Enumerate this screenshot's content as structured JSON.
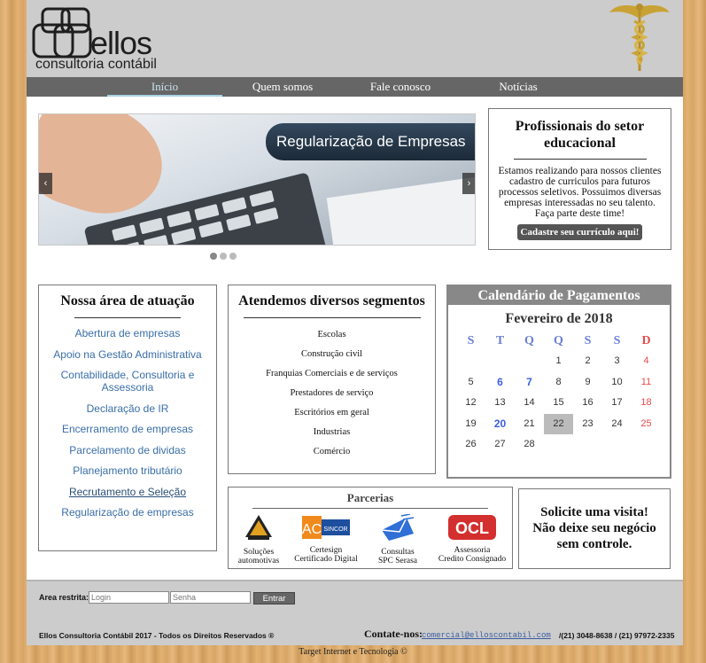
{
  "header": {
    "logo_name": "ellos",
    "logo_sub": "consultoria contábil"
  },
  "nav": {
    "items": [
      "Início",
      "Quem somos",
      "Fale conosco",
      "Notícias"
    ],
    "active": "Início"
  },
  "slider": {
    "banner": "Regularização de Empresas",
    "prev_icon": "chevron-left-icon",
    "next_icon": "chevron-right-icon",
    "prev_symbol": "‹",
    "next_symbol": "›",
    "slide_count": 3,
    "current_slide": 1
  },
  "professionals": {
    "title": "Profissionais do setor educacional",
    "text": "Estamos realizando para nossos clientes cadastro de curriculos para futuros processos seletivos. Possuimos diversas empresas interessadas no seu talento. Faça parte deste time!",
    "button": "Cadastre seu currículo aqui!"
  },
  "area": {
    "title": "Nossa área de atuação",
    "items": [
      "Abertura de empresas",
      "Apoio na Gestão Administrativa",
      "Contabilidade, Consultoria e Assessoria",
      "Declaração de IR",
      "Encerramento de empresas",
      "Parcelamento de dividas",
      "Planejamento tributário",
      "Recrutamento e Seleção",
      "Regularização de empresas"
    ]
  },
  "segments": {
    "title": "Atendemos diversos segmentos",
    "items": [
      "Escolas",
      "Construção civil",
      "Franquias Comerciais e de serviços",
      "Prestadores de serviço",
      "Escritórios em geral",
      "Industrias",
      "Comércio"
    ]
  },
  "calendar": {
    "title": "Calendário de Pagamentos",
    "month": "Fevereiro de 2018",
    "weekdays": [
      "S",
      "T",
      "Q",
      "Q",
      "S",
      "S",
      "D"
    ],
    "weeks": [
      [
        "",
        "",
        "",
        "1",
        "2",
        "3",
        "4"
      ],
      [
        "5",
        "6",
        "7",
        "8",
        "9",
        "10",
        "11"
      ],
      [
        "12",
        "13",
        "14",
        "15",
        "16",
        "17",
        "18"
      ],
      [
        "19",
        "20",
        "21",
        "22",
        "23",
        "24",
        "25"
      ],
      [
        "26",
        "27",
        "28",
        "",
        "",
        "",
        ""
      ]
    ],
    "payment_days": [
      "6",
      "7",
      "20"
    ],
    "today": "22",
    "colors": {
      "weekday": "#6a7fd6",
      "sunday": "#e84a4a",
      "payment": "#3b5fe0",
      "header": "#888888"
    }
  },
  "partners": {
    "title": "Parcerias",
    "items": [
      {
        "line1": "Soluções",
        "line2": "automotivas",
        "icon": "auto-shield-logo-icon"
      },
      {
        "line1": "Certesign",
        "line2": "Certificado Digital",
        "icon": "ac-sincor-logo-icon"
      },
      {
        "line1": "Consultas",
        "line2": "SPC Serasa",
        "icon": "envelope-logo-icon"
      },
      {
        "line1": "Assessoria",
        "line2": "Credito Consignado",
        "icon": "ocl-logo-icon"
      }
    ],
    "logo_text": {
      "ac": "AC",
      "sincor": "SINCOR",
      "ocl": "OCL"
    }
  },
  "visit": {
    "line1": "Solicite uma visita!",
    "line2": "Não deixe seu negócio",
    "line3": "sem controle."
  },
  "footer": {
    "login_label": "Area restrita:",
    "login_placeholder": "Login",
    "password_placeholder": "Senha",
    "enter_button": "Entrar",
    "copyright": "Ellos Consultoria Contábil 2017 - Todos os Direitos Reservados ®",
    "contact_label": "Contate-nos:",
    "email": "comercial@elloscontabil.com",
    "phones": "/(21) 3048-8638 / (21) 97972-2335"
  },
  "credit": "Target Internet e Tecnologia ©"
}
